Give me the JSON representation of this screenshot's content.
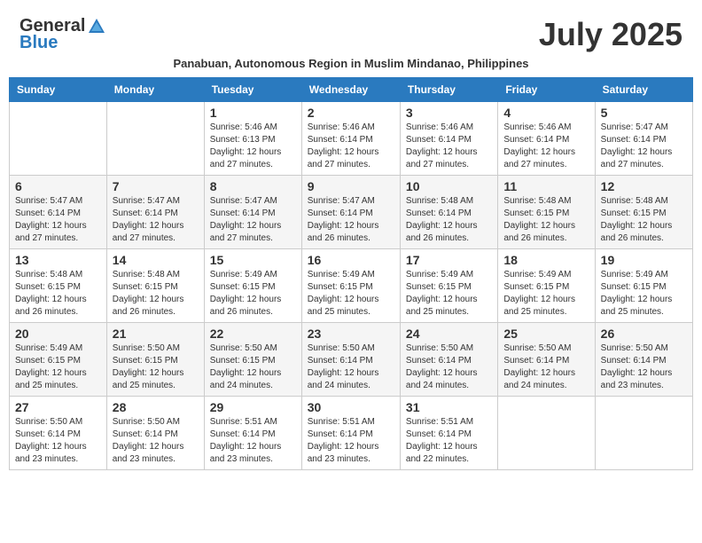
{
  "logo": {
    "general": "General",
    "blue": "Blue"
  },
  "title": "July 2025",
  "subtitle": "Panabuan, Autonomous Region in Muslim Mindanao, Philippines",
  "days_of_week": [
    "Sunday",
    "Monday",
    "Tuesday",
    "Wednesday",
    "Thursday",
    "Friday",
    "Saturday"
  ],
  "weeks": [
    [
      {
        "day": "",
        "info": ""
      },
      {
        "day": "",
        "info": ""
      },
      {
        "day": "1",
        "info": "Sunrise: 5:46 AM\nSunset: 6:13 PM\nDaylight: 12 hours and 27 minutes."
      },
      {
        "day": "2",
        "info": "Sunrise: 5:46 AM\nSunset: 6:14 PM\nDaylight: 12 hours and 27 minutes."
      },
      {
        "day": "3",
        "info": "Sunrise: 5:46 AM\nSunset: 6:14 PM\nDaylight: 12 hours and 27 minutes."
      },
      {
        "day": "4",
        "info": "Sunrise: 5:46 AM\nSunset: 6:14 PM\nDaylight: 12 hours and 27 minutes."
      },
      {
        "day": "5",
        "info": "Sunrise: 5:47 AM\nSunset: 6:14 PM\nDaylight: 12 hours and 27 minutes."
      }
    ],
    [
      {
        "day": "6",
        "info": "Sunrise: 5:47 AM\nSunset: 6:14 PM\nDaylight: 12 hours and 27 minutes."
      },
      {
        "day": "7",
        "info": "Sunrise: 5:47 AM\nSunset: 6:14 PM\nDaylight: 12 hours and 27 minutes."
      },
      {
        "day": "8",
        "info": "Sunrise: 5:47 AM\nSunset: 6:14 PM\nDaylight: 12 hours and 27 minutes."
      },
      {
        "day": "9",
        "info": "Sunrise: 5:47 AM\nSunset: 6:14 PM\nDaylight: 12 hours and 26 minutes."
      },
      {
        "day": "10",
        "info": "Sunrise: 5:48 AM\nSunset: 6:14 PM\nDaylight: 12 hours and 26 minutes."
      },
      {
        "day": "11",
        "info": "Sunrise: 5:48 AM\nSunset: 6:15 PM\nDaylight: 12 hours and 26 minutes."
      },
      {
        "day": "12",
        "info": "Sunrise: 5:48 AM\nSunset: 6:15 PM\nDaylight: 12 hours and 26 minutes."
      }
    ],
    [
      {
        "day": "13",
        "info": "Sunrise: 5:48 AM\nSunset: 6:15 PM\nDaylight: 12 hours and 26 minutes."
      },
      {
        "day": "14",
        "info": "Sunrise: 5:48 AM\nSunset: 6:15 PM\nDaylight: 12 hours and 26 minutes."
      },
      {
        "day": "15",
        "info": "Sunrise: 5:49 AM\nSunset: 6:15 PM\nDaylight: 12 hours and 26 minutes."
      },
      {
        "day": "16",
        "info": "Sunrise: 5:49 AM\nSunset: 6:15 PM\nDaylight: 12 hours and 25 minutes."
      },
      {
        "day": "17",
        "info": "Sunrise: 5:49 AM\nSunset: 6:15 PM\nDaylight: 12 hours and 25 minutes."
      },
      {
        "day": "18",
        "info": "Sunrise: 5:49 AM\nSunset: 6:15 PM\nDaylight: 12 hours and 25 minutes."
      },
      {
        "day": "19",
        "info": "Sunrise: 5:49 AM\nSunset: 6:15 PM\nDaylight: 12 hours and 25 minutes."
      }
    ],
    [
      {
        "day": "20",
        "info": "Sunrise: 5:49 AM\nSunset: 6:15 PM\nDaylight: 12 hours and 25 minutes."
      },
      {
        "day": "21",
        "info": "Sunrise: 5:50 AM\nSunset: 6:15 PM\nDaylight: 12 hours and 25 minutes."
      },
      {
        "day": "22",
        "info": "Sunrise: 5:50 AM\nSunset: 6:15 PM\nDaylight: 12 hours and 24 minutes."
      },
      {
        "day": "23",
        "info": "Sunrise: 5:50 AM\nSunset: 6:14 PM\nDaylight: 12 hours and 24 minutes."
      },
      {
        "day": "24",
        "info": "Sunrise: 5:50 AM\nSunset: 6:14 PM\nDaylight: 12 hours and 24 minutes."
      },
      {
        "day": "25",
        "info": "Sunrise: 5:50 AM\nSunset: 6:14 PM\nDaylight: 12 hours and 24 minutes."
      },
      {
        "day": "26",
        "info": "Sunrise: 5:50 AM\nSunset: 6:14 PM\nDaylight: 12 hours and 23 minutes."
      }
    ],
    [
      {
        "day": "27",
        "info": "Sunrise: 5:50 AM\nSunset: 6:14 PM\nDaylight: 12 hours and 23 minutes."
      },
      {
        "day": "28",
        "info": "Sunrise: 5:50 AM\nSunset: 6:14 PM\nDaylight: 12 hours and 23 minutes."
      },
      {
        "day": "29",
        "info": "Sunrise: 5:51 AM\nSunset: 6:14 PM\nDaylight: 12 hours and 23 minutes."
      },
      {
        "day": "30",
        "info": "Sunrise: 5:51 AM\nSunset: 6:14 PM\nDaylight: 12 hours and 23 minutes."
      },
      {
        "day": "31",
        "info": "Sunrise: 5:51 AM\nSunset: 6:14 PM\nDaylight: 12 hours and 22 minutes."
      },
      {
        "day": "",
        "info": ""
      },
      {
        "day": "",
        "info": ""
      }
    ]
  ]
}
